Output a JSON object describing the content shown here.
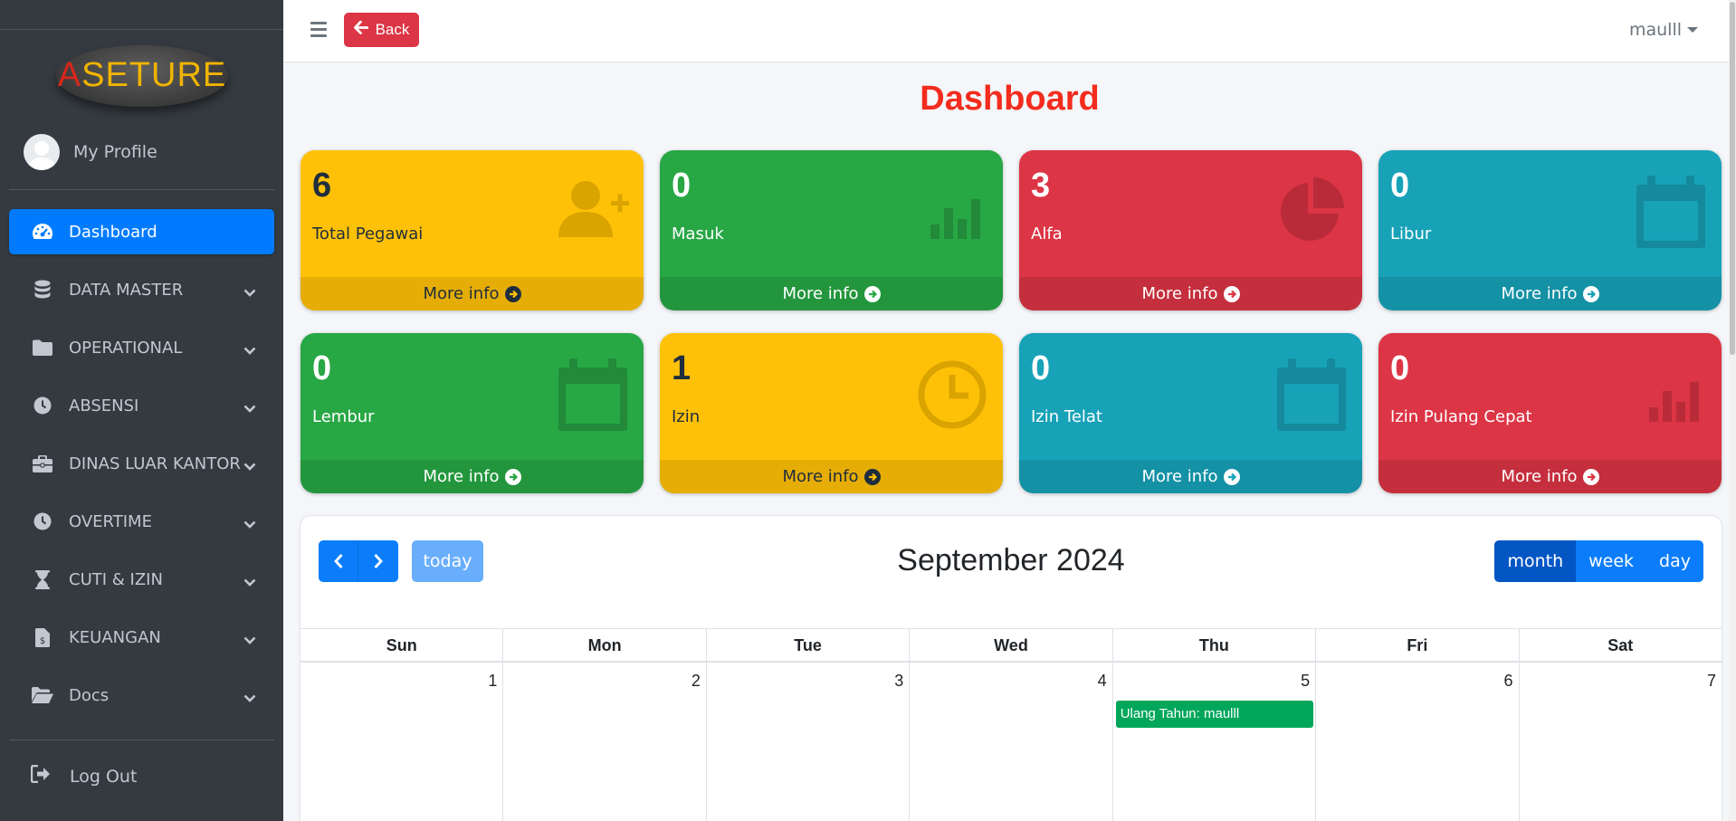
{
  "sidebar": {
    "brand": "ASETURE",
    "profile": "My Profile",
    "items": [
      {
        "label": "Dashboard",
        "icon": "tachometer-icon",
        "active": true
      },
      {
        "label": "DATA MASTER",
        "icon": "database-icon"
      },
      {
        "label": "OPERATIONAL",
        "icon": "folder-icon"
      },
      {
        "label": "ABSENSI",
        "icon": "clock-icon"
      },
      {
        "label": "DINAS LUAR KANTOR",
        "icon": "briefcase-icon"
      },
      {
        "label": "OVERTIME",
        "icon": "clock-icon"
      },
      {
        "label": "CUTI & IZIN",
        "icon": "hourglass-icon"
      },
      {
        "label": "KEUANGAN",
        "icon": "invoice-dollar-icon"
      },
      {
        "label": "Docs",
        "icon": "folder-open-icon"
      }
    ],
    "logout": "Log Out"
  },
  "header": {
    "back": "Back",
    "user": "maulll"
  },
  "page_title": "Dashboard",
  "boxes": [
    {
      "value": "6",
      "label": "Total Pegawai",
      "footer": "More info",
      "color": "#ffc107",
      "icon": "user-plus-icon"
    },
    {
      "value": "0",
      "label": "Masuk",
      "footer": "More info",
      "color": "#28a745",
      "icon": "bar-chart-icon"
    },
    {
      "value": "3",
      "label": "Alfa",
      "footer": "More info",
      "color": "#dc3545",
      "icon": "pie-chart-icon"
    },
    {
      "value": "0",
      "label": "Libur",
      "footer": "More info",
      "color": "#17a2b8",
      "icon": "calendar-icon"
    },
    {
      "value": "0",
      "label": "Lembur",
      "footer": "More info",
      "color": "#28a745",
      "icon": "calendar-icon"
    },
    {
      "value": "1",
      "label": "Izin",
      "footer": "More info",
      "color": "#ffc107",
      "icon": "clock-icon"
    },
    {
      "value": "0",
      "label": "Izin Telat",
      "footer": "More info",
      "color": "#17a2b8",
      "icon": "calendar-icon"
    },
    {
      "value": "0",
      "label": "Izin Pulang Cepat",
      "footer": "More info",
      "color": "#dc3545",
      "icon": "bar-chart-icon"
    }
  ],
  "calendar": {
    "title": "September 2024",
    "today": "today",
    "views": [
      "month",
      "week",
      "day"
    ],
    "active_view": "month",
    "weekdays": [
      "Sun",
      "Mon",
      "Tue",
      "Wed",
      "Thu",
      "Fri",
      "Sat"
    ],
    "days": [
      "1",
      "2",
      "3",
      "4",
      "5",
      "6",
      "7"
    ],
    "event": {
      "day": "5",
      "title": "Ulang Tahun: maulll",
      "color": "#00a65a"
    }
  }
}
